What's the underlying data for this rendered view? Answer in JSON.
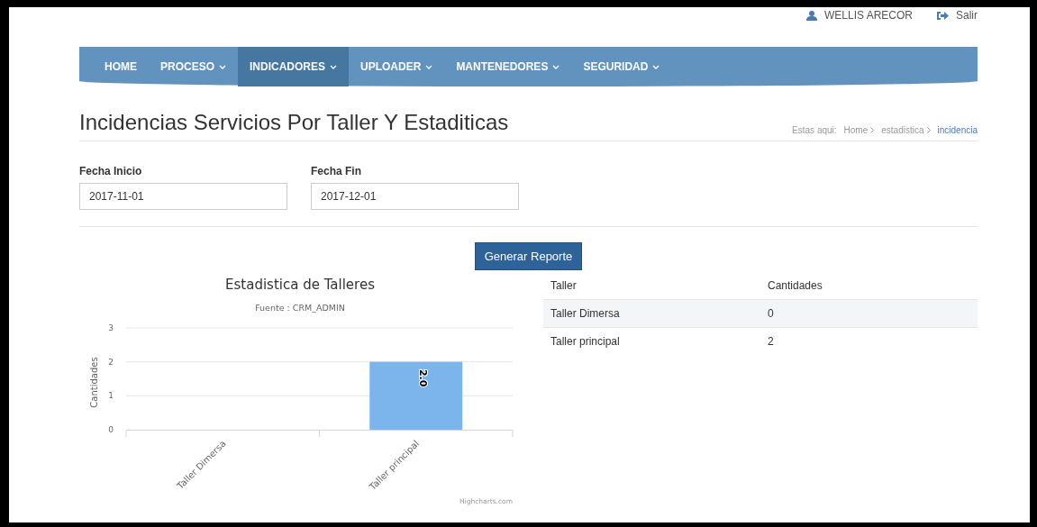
{
  "user_bar": {
    "user": "WELLIS ARECOR",
    "logout": "Salir"
  },
  "nav": [
    {
      "label": "HOME",
      "dropdown": false,
      "selected": false
    },
    {
      "label": "PROCESO",
      "dropdown": true,
      "selected": false
    },
    {
      "label": "INDICADORES",
      "dropdown": true,
      "selected": true
    },
    {
      "label": "UPLOADER",
      "dropdown": true,
      "selected": false
    },
    {
      "label": "MANTENEDORES",
      "dropdown": true,
      "selected": false
    },
    {
      "label": "SEGURIDAD",
      "dropdown": true,
      "selected": false
    }
  ],
  "page_title": "Incidencias Servicios Por Taller Y Estaditicas",
  "breadcrumb": {
    "prefix": "Estas aqui:",
    "items": [
      {
        "label": "Home",
        "current": false
      },
      {
        "label": "estadistica",
        "current": false
      },
      {
        "label": "incidencia",
        "current": true
      }
    ]
  },
  "form": {
    "fields": [
      {
        "label": "Fecha Inicio",
        "value": "2017-11-01"
      },
      {
        "label": "Fecha Fin",
        "value": "2017-12-01"
      }
    ],
    "button": "Generar Reporte"
  },
  "chart": {
    "chart_data": {
      "type": "bar",
      "title": "Estadistica de Talleres",
      "subtitle": "Fuente : CRM_ADMIN",
      "ylabel": "Cantidades",
      "categories": [
        "Taller Dimersa",
        "Taller principal"
      ],
      "series": [
        {
          "color": "#7cb5ec",
          "values": [
            0,
            2
          ]
        }
      ],
      "ylim": [
        0,
        3
      ],
      "yticks": [
        0,
        1,
        2,
        3
      ],
      "value_labels": [
        null,
        "2.0"
      ]
    },
    "credit": "Highcharts.com"
  },
  "table": {
    "columns": [
      "Taller",
      "Cantidades"
    ],
    "rows": [
      [
        "Taller Dimersa",
        "0"
      ],
      [
        "Taller principal",
        "2"
      ]
    ]
  }
}
